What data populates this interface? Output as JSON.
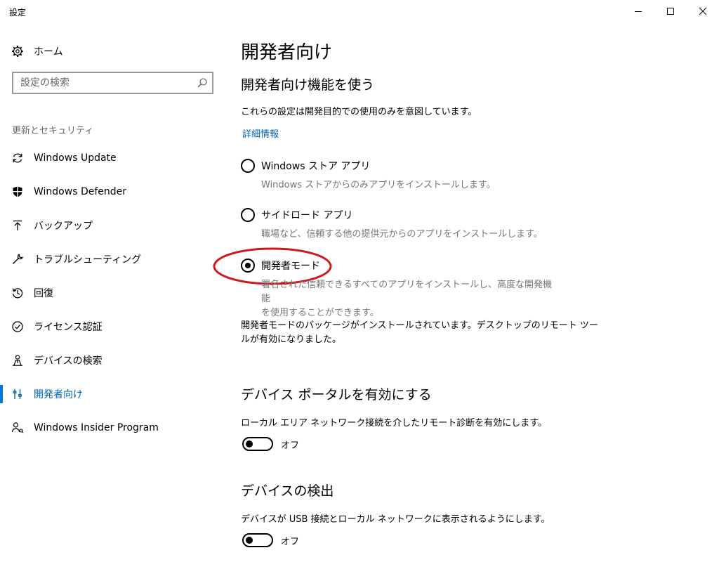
{
  "window": {
    "title": "設定"
  },
  "sidebar": {
    "home_label": "ホーム",
    "search_placeholder": "設定の検索",
    "section_header": "更新とセキュリティ",
    "items": [
      {
        "label": "Windows Update",
        "icon": "refresh-icon",
        "active": false
      },
      {
        "label": "Windows Defender",
        "icon": "shield-icon",
        "active": false
      },
      {
        "label": "バックアップ",
        "icon": "upload-icon",
        "active": false
      },
      {
        "label": "トラブルシューティング",
        "icon": "wrench-icon",
        "active": false
      },
      {
        "label": "回復",
        "icon": "history-icon",
        "active": false
      },
      {
        "label": "ライセンス認証",
        "icon": "check-circle-icon",
        "active": false
      },
      {
        "label": "デバイスの検索",
        "icon": "person-location-icon",
        "active": false
      },
      {
        "label": "開発者向け",
        "icon": "developer-tools-icon",
        "active": true
      },
      {
        "label": "Windows Insider Program",
        "icon": "insider-icon",
        "active": false
      }
    ]
  },
  "main": {
    "page_title": "開発者向け",
    "use_features": {
      "heading": "開発者向け機能を使う",
      "description": "これらの設定は開発目的での使用のみを意図しています。",
      "link": "詳細情報"
    },
    "options": [
      {
        "label": "Windows ストア アプリ",
        "description": "Windows ストアからのみアプリをインストールします。",
        "selected": false
      },
      {
        "label": "サイドロード アプリ",
        "description": "職場など、信頼する他の提供元からのアプリをインストールします。",
        "selected": false
      },
      {
        "label": "開発者モード",
        "description_line1": "署名された信頼できるすべてのアプリをインストールし、高度な開発機能",
        "description_line2": "を使用することができます。",
        "selected": true
      }
    ],
    "status_line1": "開発者モードのパッケージがインストールされています。デスクトップのリモート ツー",
    "status_line2": "ルが有効になりました。",
    "device_portal": {
      "heading": "デバイス ポータルを有効にする",
      "description": "ローカル エリア ネットワーク接続を介したリモート診断を有効にします。",
      "toggle_label": "オフ",
      "toggle_on": false
    },
    "device_discovery": {
      "heading": "デバイスの検出",
      "description": "デバイスが USB 接続とローカル ネットワークに表示されるようにします。",
      "toggle_label": "オフ",
      "toggle_on": false
    }
  },
  "colors": {
    "accent": "#0078d7",
    "link": "#0063b1",
    "annotation": "#d0191c",
    "secondary_text": "#767676"
  }
}
